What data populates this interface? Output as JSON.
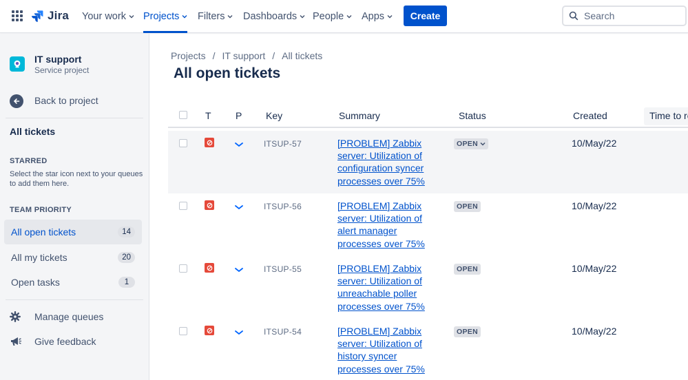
{
  "topnav": {
    "logo_text": "Jira",
    "items": [
      {
        "label": "Your work"
      },
      {
        "label": "Projects"
      },
      {
        "label": "Filters"
      },
      {
        "label": "Dashboards"
      },
      {
        "label": "People"
      },
      {
        "label": "Apps"
      }
    ],
    "create_label": "Create",
    "search_placeholder": "Search",
    "active_item": "Projects",
    "accent_color": "#0052cc"
  },
  "sidebar": {
    "project_name": "IT support",
    "project_type": "Service project",
    "back_label": "Back to project",
    "all_tickets_label": "All tickets",
    "starred_heading": "STARRED",
    "starred_hint": "Select the star icon next to your queues to add them here.",
    "team_priority_heading": "TEAM PRIORITY",
    "queues": [
      {
        "label": "All open tickets",
        "count": "14",
        "selected": true
      },
      {
        "label": "All my tickets",
        "count": "20",
        "selected": false
      },
      {
        "label": "Open tasks",
        "count": "1",
        "selected": false
      }
    ],
    "manage_queues_label": "Manage queues",
    "give_feedback_label": "Give feedback"
  },
  "main": {
    "breadcrumb": [
      "Projects",
      "IT support",
      "All tickets"
    ],
    "breadcrumb_separator": "/",
    "title": "All open tickets",
    "columns": {
      "t": "T",
      "p": "P",
      "key": "Key",
      "summary": "Summary",
      "status": "Status",
      "created": "Created",
      "time_to": "Time to re"
    },
    "rows": [
      {
        "key": "ITSUP-57",
        "summary": "[PROBLEM] Zabbix server: Utilization of configuration syncer processes over 75%",
        "status": "OPEN",
        "created": "10/May/22"
      },
      {
        "key": "ITSUP-56",
        "summary": "[PROBLEM] Zabbix server: Utilization of alert manager processes over 75%",
        "status": "OPEN",
        "created": "10/May/22"
      },
      {
        "key": "ITSUP-55",
        "summary": "[PROBLEM] Zabbix server: Utilization of unreachable poller processes over 75%",
        "status": "OPEN",
        "created": "10/May/22"
      },
      {
        "key": "ITSUP-54",
        "summary": "[PROBLEM] Zabbix server: Utilization of history syncer processes over 75%",
        "status": "OPEN",
        "created": "10/May/22"
      }
    ]
  }
}
